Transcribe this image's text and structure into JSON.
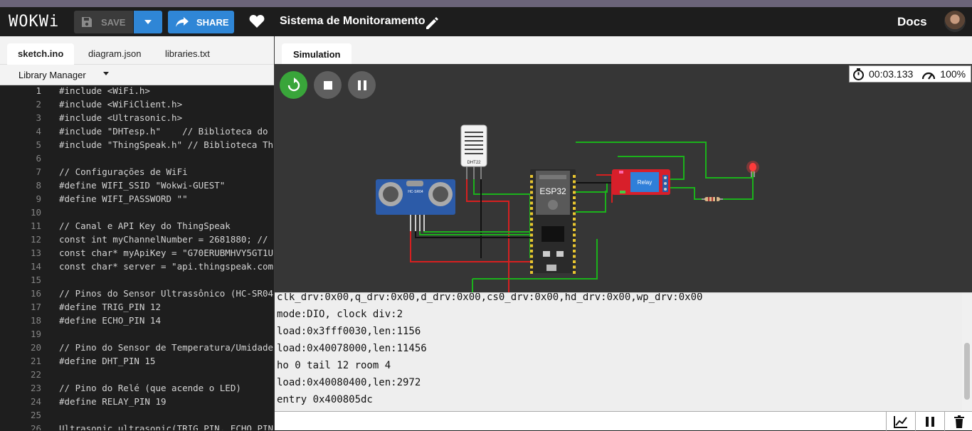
{
  "header": {
    "logo": "WOKWi",
    "save_label": "SAVE",
    "share_label": "SHARE",
    "project_title": "Sistema de Monitoramento",
    "docs_label": "Docs"
  },
  "editor": {
    "tabs": [
      {
        "label": "sketch.ino",
        "active": true
      },
      {
        "label": "diagram.json",
        "active": false
      },
      {
        "label": "libraries.txt",
        "active": false
      }
    ],
    "library_manager": "Library Manager",
    "lines": [
      {
        "n": "1",
        "text": "#include <WiFi.h>"
      },
      {
        "n": "2",
        "text": "#include <WiFiClient.h>"
      },
      {
        "n": "3",
        "text": "#include <Ultrasonic.h>"
      },
      {
        "n": "4",
        "text": "#include \"DHTesp.h\"    // Biblioteca do"
      },
      {
        "n": "5",
        "text": "#include \"ThingSpeak.h\" // Biblioteca Th"
      },
      {
        "n": "6",
        "text": ""
      },
      {
        "n": "7",
        "text": "// Configurações de WiFi"
      },
      {
        "n": "8",
        "text": "#define WIFI_SSID \"Wokwi-GUEST\""
      },
      {
        "n": "9",
        "text": "#define WIFI_PASSWORD \"\""
      },
      {
        "n": "10",
        "text": ""
      },
      {
        "n": "11",
        "text": "// Canal e API Key do ThingSpeak"
      },
      {
        "n": "12",
        "text": "const int myChannelNumber = 2681880; //"
      },
      {
        "n": "13",
        "text": "const char* myApiKey = \"G70ERUBMHVY5GT1U"
      },
      {
        "n": "14",
        "text": "const char* server = \"api.thingspeak.com"
      },
      {
        "n": "15",
        "text": ""
      },
      {
        "n": "16",
        "text": "// Pinos do Sensor Ultrassônico (HC-SR04"
      },
      {
        "n": "17",
        "text": "#define TRIG_PIN 12"
      },
      {
        "n": "18",
        "text": "#define ECHO_PIN 14"
      },
      {
        "n": "19",
        "text": ""
      },
      {
        "n": "20",
        "text": "// Pino do Sensor de Temperatura/Umidade"
      },
      {
        "n": "21",
        "text": "#define DHT_PIN 15"
      },
      {
        "n": "22",
        "text": ""
      },
      {
        "n": "23",
        "text": "// Pino do Relé (que acende o LED)"
      },
      {
        "n": "24",
        "text": "#define RELAY_PIN 19"
      },
      {
        "n": "25",
        "text": ""
      },
      {
        "n": "26",
        "text": "Ultrasonic ultrasonic(TRIG_PIN, ECHO_PIN"
      }
    ]
  },
  "simulation": {
    "tab_label": "Simulation",
    "timer": "00:03.133",
    "speed": "100%",
    "parts": {
      "dht_label": "DHT22",
      "esp_label": "ESP32",
      "sonar_label": "HC-SR04",
      "relay_label": "Relay"
    },
    "colors": {
      "canvas_bg": "#363636",
      "restart_btn": "#39a53a",
      "stop_btn": "#5f5f5f",
      "wire_green": "#1bb21b",
      "wire_red": "#d62020",
      "led_red": "#ff3b3b"
    }
  },
  "serial": {
    "lines": [
      "clk_drv:0x00,q_drv:0x00,d_drv:0x00,cs0_drv:0x00,hd_drv:0x00,wp_drv:0x00",
      "mode:DIO, clock div:2",
      "load:0x3fff0030,len:1156",
      "load:0x40078000,len:11456",
      "ho 0 tail 12 room 4",
      "load:0x40080400,len:2972",
      "entry 0x400805dc"
    ]
  }
}
